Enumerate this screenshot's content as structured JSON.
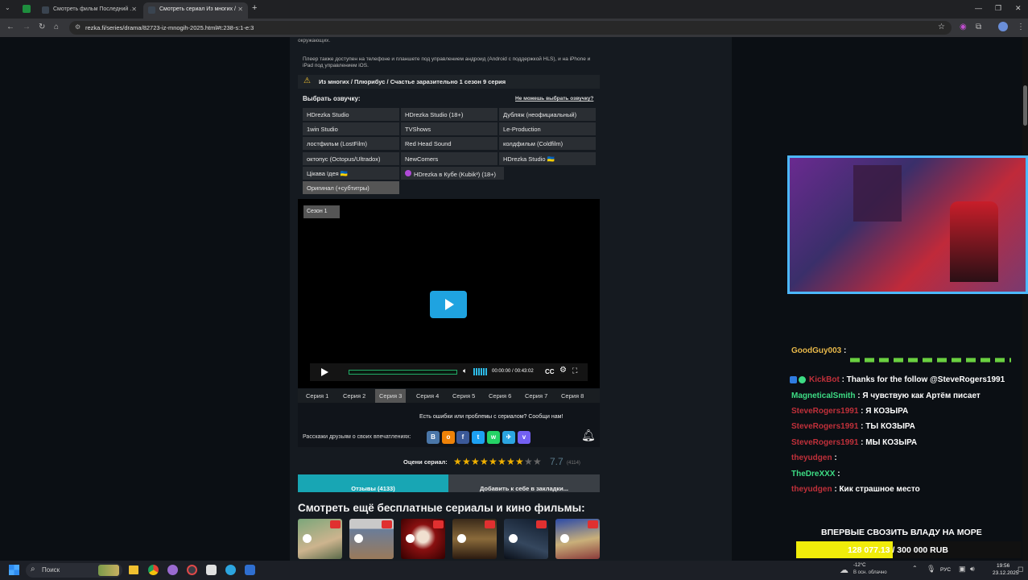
{
  "browser": {
    "tabs": [
      {
        "label": "Смотреть фильм Последний ."
      },
      {
        "label": "Смотреть сериал Из многих /"
      }
    ],
    "url": "rezka.fi/series/drama/82723-iz-mnogih-2025.html#t:238-s:1-e:3"
  },
  "page": {
    "intro_tail": "окружающих.",
    "platform_note": "Плеер также доступен на телефоне и планшете под управлением андроид (Android с поддержкой HLS), и на iPhone и iPad под управлением iOS.",
    "warning_title": "Из многих / Плюрибус / Счастье заразительно 1 сезон 9 серия",
    "voice_heading": "Выбрать озвучку:",
    "voice_help_link": "Не можешь выбрать озвучку?",
    "voices": [
      "HDrezka Studio",
      "HDrezka Studio (18+)",
      "Дубляж (неофициальный)",
      "1win Studio",
      "TVShows",
      "Le-Production",
      "лостфильм (LostFilm)",
      "Red Head Sound",
      "колдфильм (Coldfilm)",
      "октопус (Octopus/Ultradox)",
      "NewComers",
      "HDrezka Studio 🇺🇦",
      "Цікава Ідея 🇺🇦",
      "HDrezka в Кубе (Kubik³) (18+)",
      "Оригинал (+субтитры)"
    ],
    "season_label": "Сезон 1",
    "player_time": "00:00:00 / 00:43:02",
    "cc_label": "CC",
    "episodes": [
      "Серия 1",
      "Серия 2",
      "Серия 3",
      "Серия 4",
      "Серия 5",
      "Серия 6",
      "Серия 7",
      "Серия 8"
    ],
    "error_report": "Есть ошибки или проблемы с сериалом? Сообщи нам!",
    "share_label": "Расскажи друзьям о своих впечатлениях:",
    "rate_label": "Оцени сериал:",
    "rating_value": "7.7",
    "rating_count": "(4114)",
    "reviews_button": "Отзывы (4133)",
    "bookmark_button": "Добавить к себе в закладки...",
    "more_heading": "Смотреть ещё бесплатные сериалы и кино фильмы:"
  },
  "stream": {
    "chat": [
      {
        "user": "GoodGuy003",
        "user_color": "#e8b84a",
        "text": ""
      },
      {
        "user": "KickBot",
        "user_color": "#c0303a",
        "text": "Thanks for the follow @SteveRogers1991"
      },
      {
        "user": "MagneticalSmith",
        "user_color": "#3ddc84",
        "text": "Я чувствую как Артём писает"
      },
      {
        "user": "SteveRogers1991",
        "user_color": "#c0303a",
        "text": "Я КОЗЫРА"
      },
      {
        "user": "SteveRogers1991",
        "user_color": "#c0303a",
        "text": "ТЫ КОЗЫРА"
      },
      {
        "user": "SteveRogers1991",
        "user_color": "#c0303a",
        "text": "МЫ КОЗЫРА"
      },
      {
        "user": "theyudgen",
        "user_color": "#c0303a",
        "text": ""
      },
      {
        "user": "TheDreXXX",
        "user_color": "#3ddc84",
        "text": ""
      },
      {
        "user": "theyudgen",
        "user_color": "#c0303a",
        "text": "Кик страшное место"
      }
    ],
    "goal_title": "ВПЕРВЫЕ СВОЗИТЬ ВЛАДУ НА МОРЕ",
    "goal_amount": "128 077.13 / 300 000 RUB",
    "goal_fraction": 0.427
  },
  "taskbar": {
    "search_placeholder": "Поиск",
    "weather_temp": "-12°C",
    "weather_desc": "В осн. облачно",
    "lang": "РУС",
    "time": "19:56",
    "date": "23.12.2025"
  }
}
